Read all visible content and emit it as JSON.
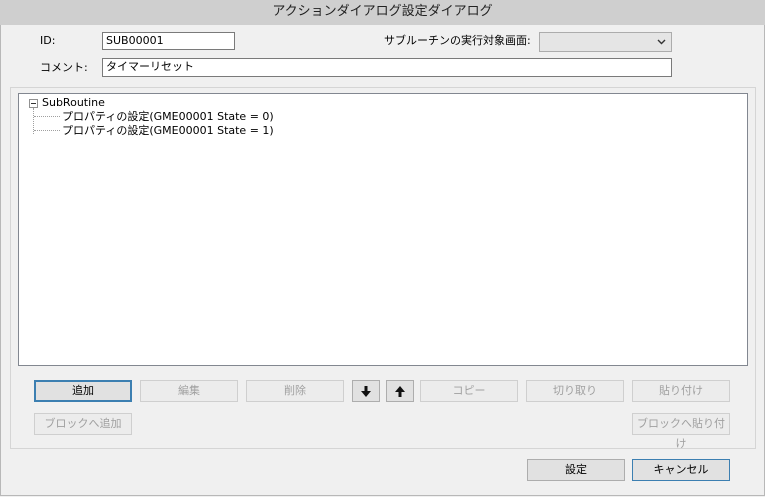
{
  "window": {
    "title": "アクションダイアログ設定ダイアログ"
  },
  "form": {
    "id_label": "ID:",
    "id_value": "SUB00001",
    "target_screen_label": "サブルーチンの実行対象画面:",
    "target_screen_value": "",
    "comment_label": "コメント:",
    "comment_value": "タイマーリセット"
  },
  "tree": {
    "root": "SubRoutine",
    "children": [
      "プロパティの設定(GME00001 State = 0)",
      "プロパティの設定(GME00001 State = 1)"
    ]
  },
  "toolbar": {
    "add": "追加",
    "edit": "編集",
    "delete": "削除",
    "move_down": "arrow-down",
    "move_up": "arrow-up",
    "copy": "コピー",
    "cut": "切り取り",
    "paste": "貼り付け",
    "add_to_block": "ブロックへ追加",
    "paste_to_block": "ブロックへ貼り付け"
  },
  "footer": {
    "ok": "設定",
    "cancel": "キャンセル"
  }
}
